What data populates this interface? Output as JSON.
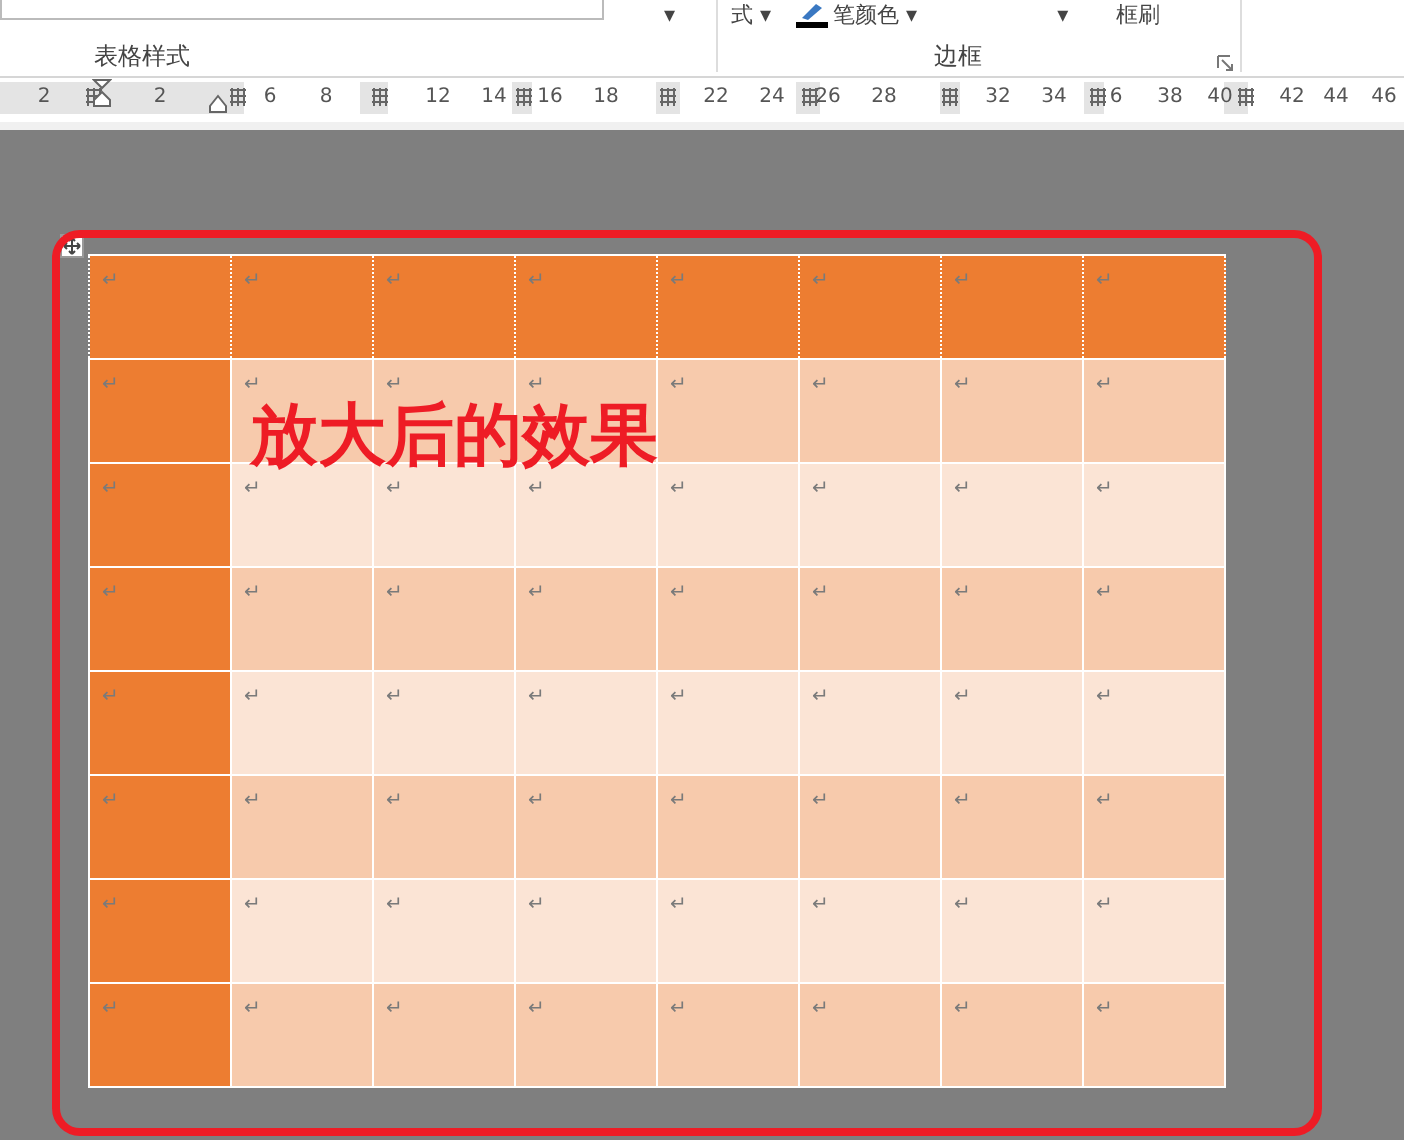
{
  "ribbon": {
    "partial_items": [
      {
        "kind": "caret",
        "text": "▾"
      },
      {
        "kind": "text",
        "text": "式 ▾"
      },
      {
        "kind": "pen",
        "text": "笔颜色 ▾"
      },
      {
        "kind": "caret",
        "text": "▾"
      },
      {
        "kind": "text",
        "text": "框刷"
      }
    ],
    "groups": [
      {
        "label": "表格样式"
      },
      {
        "label": "边框"
      }
    ]
  },
  "ruler": {
    "numbers": [
      "2",
      "2",
      "6",
      "8",
      "12",
      "14",
      "16",
      "18",
      "22",
      "24",
      "26",
      "28",
      "32",
      "34",
      "6",
      "38",
      "40",
      "42",
      "44",
      "46"
    ]
  },
  "table": {
    "header_row": true,
    "first_column": true,
    "banded_rows": true,
    "rows": [
      [
        "↵",
        "↵",
        "↵",
        "↵",
        "↵",
        "↵",
        "↵",
        "↵"
      ],
      [
        "↵",
        "↵",
        "↵",
        "↵",
        "↵",
        "↵",
        "↵",
        "↵"
      ],
      [
        "↵",
        "↵",
        "↵",
        "↵",
        "↵",
        "↵",
        "↵",
        "↵"
      ],
      [
        "↵",
        "↵",
        "↵",
        "↵",
        "↵",
        "↵",
        "↵",
        "↵"
      ],
      [
        "↵",
        "↵",
        "↵",
        "↵",
        "↵",
        "↵",
        "↵",
        "↵"
      ],
      [
        "↵",
        "↵",
        "↵",
        "↵",
        "↵",
        "↵",
        "↵",
        "↵"
      ],
      [
        "↵",
        "↵",
        "↵",
        "↵",
        "↵",
        "↵",
        "↵",
        "↵"
      ],
      [
        "↵",
        "↵",
        "↵",
        "↵",
        "↵",
        "↵",
        "↵",
        "↵"
      ]
    ]
  },
  "annotation": {
    "text": "放大后的效果"
  }
}
